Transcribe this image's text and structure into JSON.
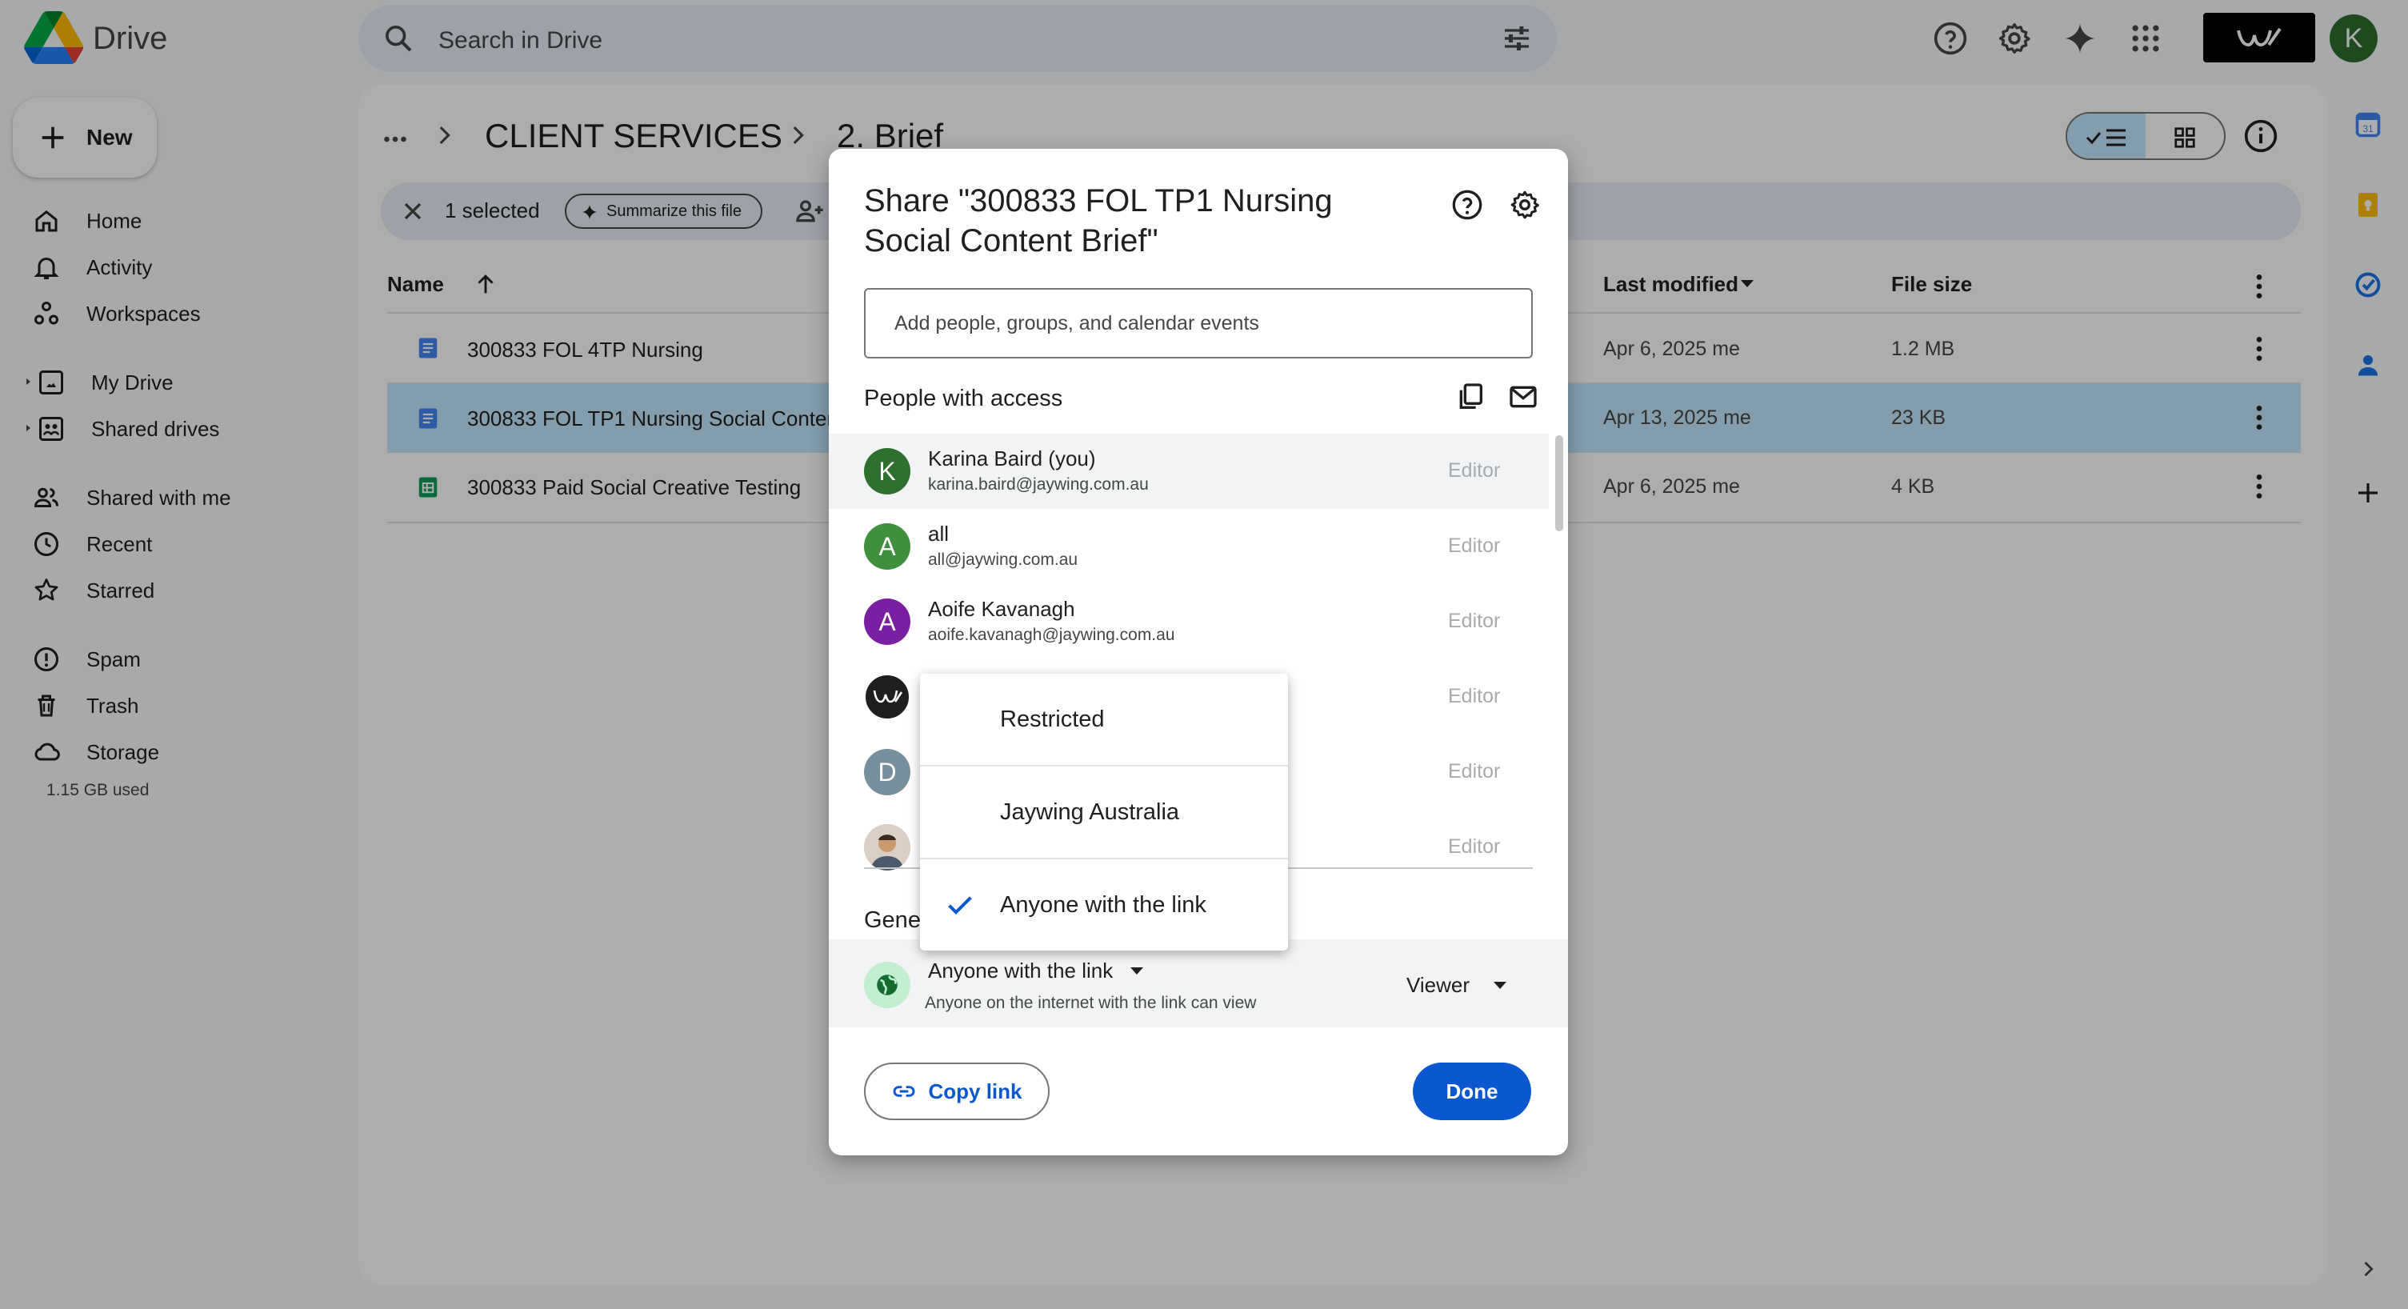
{
  "app": {
    "title": "Drive"
  },
  "search": {
    "placeholder": "Search in Drive"
  },
  "new_button": {
    "label": "New"
  },
  "nav": [
    {
      "label": "Home",
      "icon": "home-icon"
    },
    {
      "label": "Activity",
      "icon": "bell-icon"
    },
    {
      "label": "Workspaces",
      "icon": "workspaces-icon"
    },
    {
      "label": "My Drive",
      "icon": "my-drive-icon"
    },
    {
      "label": "Shared drives",
      "icon": "shared-drives-icon"
    },
    {
      "label": "Shared with me",
      "icon": "people-icon"
    },
    {
      "label": "Recent",
      "icon": "clock-icon"
    },
    {
      "label": "Starred",
      "icon": "star-icon"
    },
    {
      "label": "Spam",
      "icon": "spam-icon"
    },
    {
      "label": "Trash",
      "icon": "trash-icon"
    },
    {
      "label": "Storage",
      "icon": "cloud-icon"
    }
  ],
  "storage_used": "1.15 GB used",
  "breadcrumb": {
    "parent": "CLIENT SERVICES",
    "current": "2. Brief"
  },
  "selection_bar": {
    "count": "1 selected",
    "summarize": "Summarize this file"
  },
  "table": {
    "headers": {
      "name": "Name",
      "modified": "Last modified",
      "size": "File size"
    },
    "rows": [
      {
        "name": "300833 FOL 4TP Nursing",
        "modified": "Apr 6, 2025 me",
        "size": "1.2 MB",
        "type": "doc"
      },
      {
        "name": "300833 FOL TP1 Nursing Social Content Brief",
        "modified": "Apr 13, 2025 me",
        "size": "23 KB",
        "type": "doc"
      },
      {
        "name": "300833 Paid Social Creative Testing",
        "modified": "Apr 6, 2025 me",
        "size": "4 KB",
        "type": "sheet"
      }
    ]
  },
  "dialog": {
    "title": "Share \"300833 FOL TP1 Nursing Social Content Brief\"",
    "add_placeholder": "Add people, groups, and calendar events",
    "people_heading": "People with access",
    "people": [
      {
        "initial": "K",
        "name": "Karina Baird (you)",
        "email": "karina.baird@jaywing.com.au",
        "role": "Editor",
        "color": "#2e6e2e"
      },
      {
        "initial": "A",
        "name": "all",
        "email": "all@jaywing.com.au",
        "role": "Editor",
        "color": "#3f8f3f"
      },
      {
        "initial": "A",
        "name": "Aoife Kavanagh",
        "email": "aoife.kavanagh@jaywing.com.au",
        "role": "Editor",
        "color": "#7b1fa2"
      },
      {
        "initial": "W",
        "name": "",
        "email": "",
        "role": "Editor",
        "color": "#1f1f1f"
      },
      {
        "initial": "D",
        "name": "",
        "email": "",
        "role": "Editor",
        "color": "#78909c"
      },
      {
        "initial": "",
        "name": "",
        "email": "",
        "role": "Editor",
        "color": "#c9a27e"
      }
    ],
    "general_heading": "Gene",
    "general_access": {
      "selected": "Anyone with the link",
      "description": "Anyone on the internet with the link can view",
      "role": "Viewer"
    },
    "copy_link": "Copy link",
    "done": "Done"
  },
  "access_menu": {
    "options": [
      "Restricted",
      "Jaywing Australia",
      "Anyone with the link"
    ],
    "checked_index": 2
  },
  "colors": {
    "accent": "#0b57d0",
    "selected_row": "#c2e7ff"
  }
}
